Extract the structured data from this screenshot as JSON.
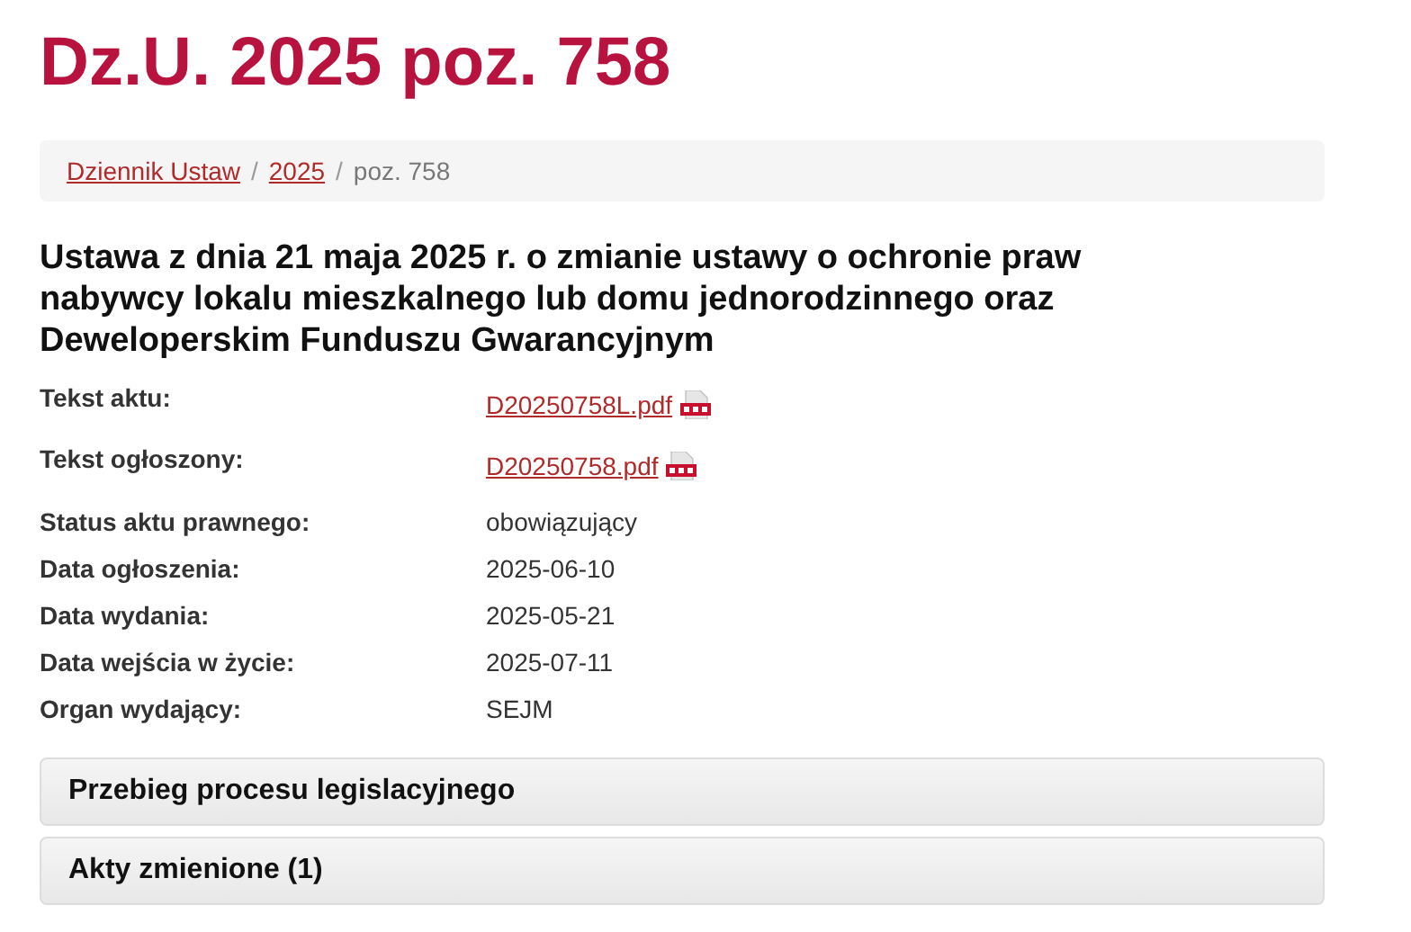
{
  "title": "Dz.U. 2025 poz. 758",
  "breadcrumb_separator": "/",
  "breadcrumb": [
    {
      "label": "Dziennik Ustaw",
      "kind": "link"
    },
    {
      "label": "2025",
      "kind": "link"
    },
    {
      "label": "poz. 758",
      "kind": "current"
    }
  ],
  "act_title": "Ustawa z dnia 21 maja 2025 r. o zmianie ustawy o ochronie praw nabywcy lokalu mieszkalnego lub domu jednorodzinnego oraz Deweloperskim Funduszu Gwarancyjnym",
  "details": [
    {
      "label": "Tekst aktu:",
      "value": "D20250758L.pdf",
      "kind": "pdf"
    },
    {
      "label": "Tekst ogłoszony:",
      "value": "D20250758.pdf",
      "kind": "pdf"
    },
    {
      "label": "Status aktu prawnego:",
      "value": "obowiązujący",
      "kind": "text"
    },
    {
      "label": "Data ogłoszenia:",
      "value": "2025-06-10",
      "kind": "text"
    },
    {
      "label": "Data wydania:",
      "value": "2025-05-21",
      "kind": "text"
    },
    {
      "label": "Data wejścia w życie:",
      "value": "2025-07-11",
      "kind": "text"
    },
    {
      "label": "Organ wydający:",
      "value": "SEJM",
      "kind": "text"
    }
  ],
  "panels": [
    {
      "title": "Przebieg procesu legislacyjnego"
    },
    {
      "title": "Akty zmienione (1)"
    }
  ]
}
